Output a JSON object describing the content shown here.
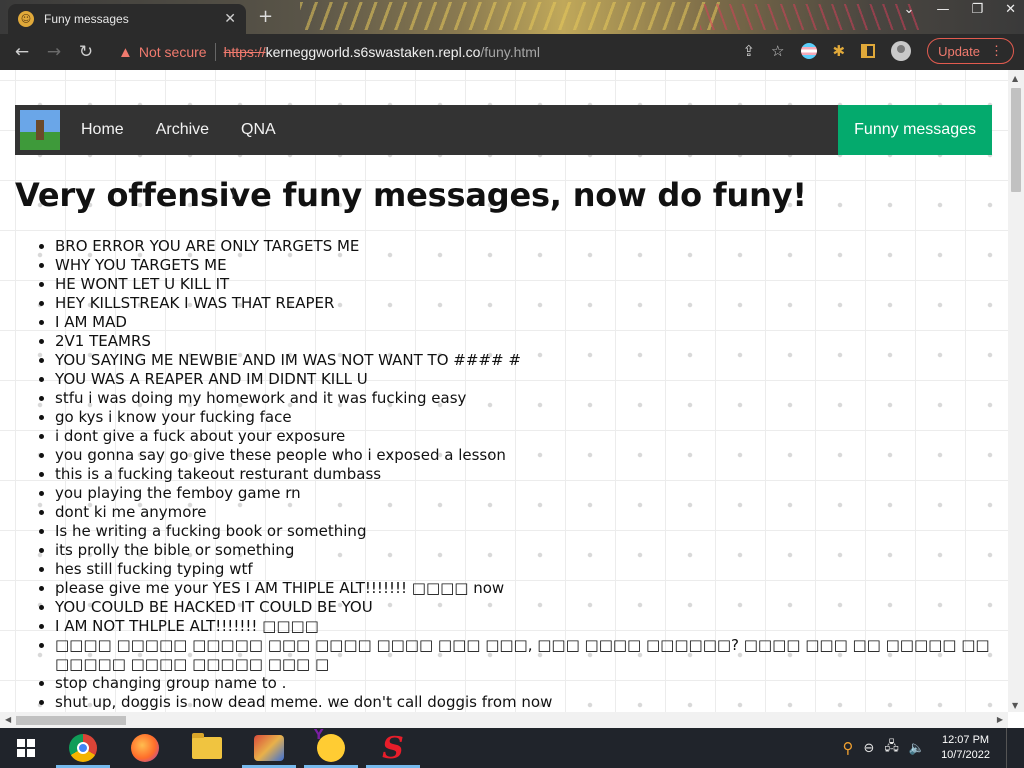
{
  "browser": {
    "tab_title": "Funy messages",
    "tab_close": "✕",
    "new_tab": "+",
    "window_buttons": [
      "⌄",
      "—",
      "❐",
      "✕"
    ],
    "back": "←",
    "forward": "→",
    "reload": "↻",
    "security_label": "Not secure",
    "url_scheme": "https://",
    "url_host": "kerneggworld.s6swastaken.repl.co",
    "url_path": "/funy.html",
    "update_label": "Update",
    "share": "⇪",
    "bookmark": "☆",
    "puzzle": "✱",
    "menu": "⋮"
  },
  "site": {
    "nav": [
      {
        "label": "Home"
      },
      {
        "label": "Archive"
      },
      {
        "label": "QNA"
      }
    ],
    "nav_active": "Funny messages",
    "heading": "Very offensive funy messages, now do funy!",
    "messages": [
      "BRO ERROR YOU ARE ONLY TARGETS ME",
      "WHY YOU TARGETS ME",
      "HE WONT LET U KILL IT",
      "HEY KILLSTREAK I WAS THAT REAPER",
      "I AM MAD",
      "2V1 TEAMRS",
      "YOU SAYING ME NEWBIE AND IM WAS NOT WANT TO #### #",
      "YOU WAS A REAPER AND IM DIDNT KILL U",
      "stfu i was doing my homework and it was fucking easy",
      "go kys i know your fucking face",
      "i dont give a fuck about your exposure",
      "you gonna say go give these people who i exposed a lesson",
      "this is a fucking takeout resturant dumbass",
      "you playing the femboy game rn",
      "dont ki me anymore",
      "Is he writing a fucking book or something",
      "its prolly the bible or something",
      "hes still fucking typing wtf",
      "please give me your YES I AM THIPLE ALT!!!!!!! □□□□ now",
      "YOU COULD BE HACKED IT COULD BE YOU",
      "I AM NOT THLPLE ALT!!!!!!! □□□□",
      "□□□□ □□□□□ □□□□□ □□□ □□□□ □□□□ □□□ □□□, □□□ □□□□ □□□□□□? □□□□ □□□ □□ □□□□□ □□ □□□□□ □□□□ □□□□□ □□□ □",
      "stop changing group name to .",
      "shut up, doggis is now dead meme. we don't call doggis from now"
    ]
  },
  "taskbar": {
    "time": "12:07 PM",
    "date": "10/7/2022",
    "apps": [
      "chrome-icon",
      "firefox-icon",
      "file-explorer-icon",
      "paint-icon",
      "yahoo-messenger-icon",
      "s-app-icon"
    ]
  }
}
